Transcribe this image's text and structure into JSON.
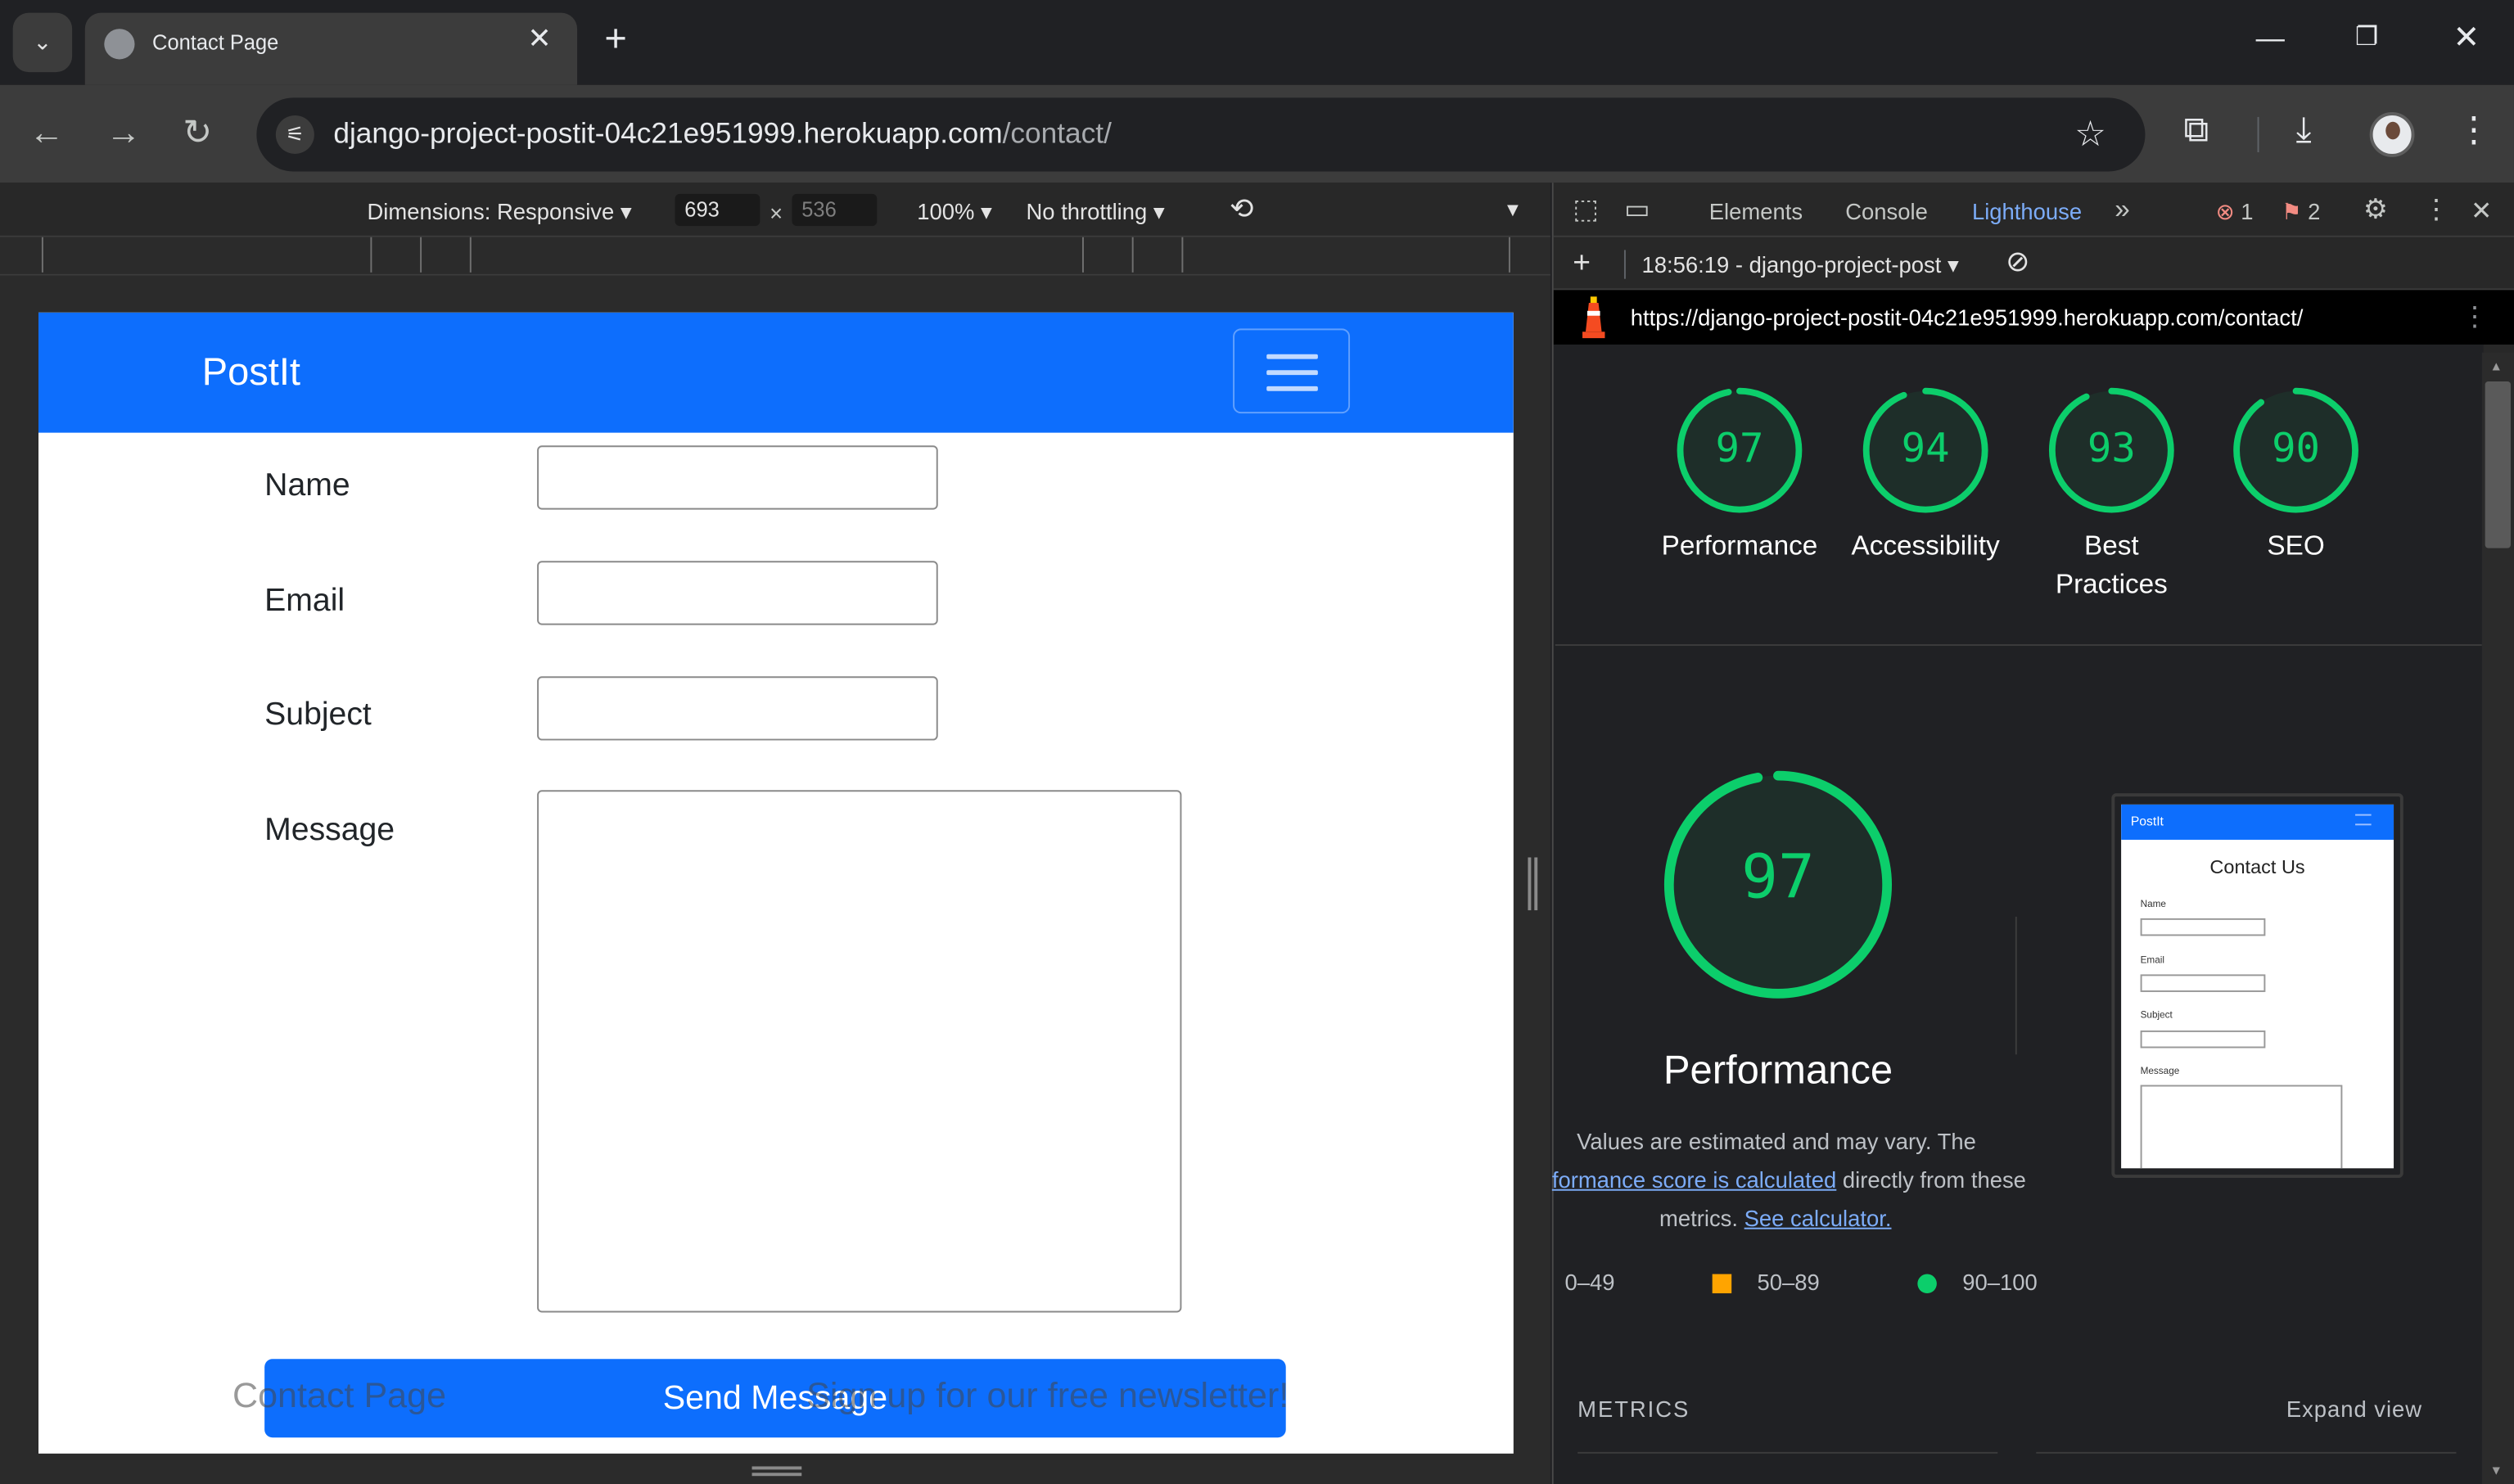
{
  "browser": {
    "tab_title": "Contact Page",
    "url_host": "django-project-postit-04c21e951999.herokuapp.com",
    "url_path": "/contact/"
  },
  "device_toolbar": {
    "dimensions_label": "Dimensions: Responsive",
    "width": "693",
    "height": "536",
    "zoom": "100%",
    "throttling": "No throttling"
  },
  "page": {
    "brand": "PostIt",
    "fields": [
      {
        "label": "Name"
      },
      {
        "label": "Email"
      },
      {
        "label": "Subject"
      },
      {
        "label": "Message"
      }
    ],
    "send_button": "Send Message",
    "footer_left": "Contact Page",
    "footer_right": "Sign up for our free newsletter!"
  },
  "devtools": {
    "tabs": [
      "Elements",
      "Console",
      "Lighthouse"
    ],
    "active_tab": "Lighthouse",
    "errors": "1",
    "issues": "2",
    "report_label": "18:56:19 - django-project-post",
    "report_url": "https://django-project-postit-04c21e951999.herokuapp.com/contact/",
    "scores": [
      {
        "value": "97",
        "label": "Performance"
      },
      {
        "value": "94",
        "label": "Accessibility"
      },
      {
        "value": "93",
        "label": "Best Practices"
      },
      {
        "value": "90",
        "label": "SEO"
      }
    ],
    "perf": {
      "value": "97",
      "title": "Performance",
      "desc1": "Values are estimated and may vary. The",
      "link1": "formance score is calculated",
      "desc2": " directly from these",
      "desc3": "metrics. ",
      "link2": "See calculator."
    },
    "legend": {
      "low": "0–49",
      "mid": "50–89",
      "high": "90–100"
    },
    "metrics_heading": "METRICS",
    "expand_view": "Expand view",
    "thumbnail": {
      "brand": "PostIt",
      "heading": "Contact Us",
      "labels": [
        "Name",
        "Email",
        "Subject",
        "Message"
      ]
    },
    "colors": {
      "pass": "#0cce6b",
      "average": "#ffa400",
      "fail": "#ff4e42",
      "accent": "#7cacf8"
    }
  }
}
